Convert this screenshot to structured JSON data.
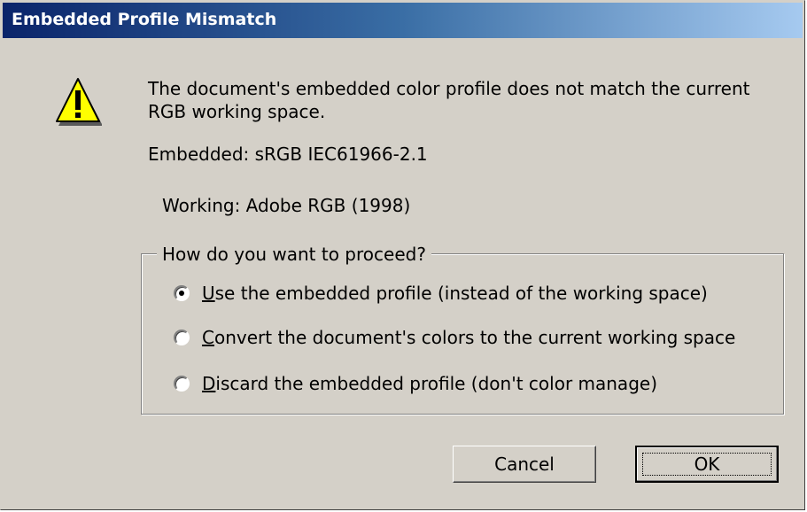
{
  "window": {
    "title": "Embedded Profile Mismatch",
    "title_gradient": [
      "#0a246a",
      "#a6caf0"
    ],
    "background": "#d4d0c8"
  },
  "icon": "warning-triangle-icon",
  "message": {
    "line1": "The document's embedded color profile does not match the current RGB working space.",
    "embedded": "Embedded: sRGB IEC61966-2.1",
    "working": "Working: Adobe RGB (1998)"
  },
  "options": {
    "legend": "How do you want to proceed?",
    "items": [
      {
        "mnemonic": "U",
        "rest": "se the embedded profile (instead of the working space)",
        "checked": true
      },
      {
        "mnemonic": "C",
        "rest": "onvert the document's colors to the current working space",
        "checked": false
      },
      {
        "mnemonic": "D",
        "rest": "iscard the embedded profile (don't color manage)",
        "checked": false
      }
    ]
  },
  "buttons": {
    "cancel": "Cancel",
    "ok": "OK"
  }
}
